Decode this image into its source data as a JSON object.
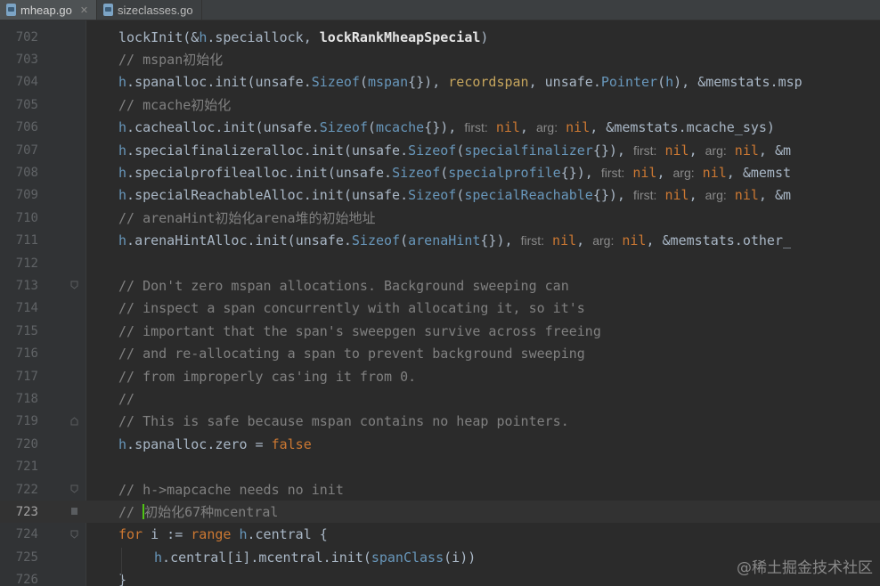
{
  "tabs": [
    {
      "label": "mheap.go",
      "active": true,
      "icon": "go-file-icon"
    },
    {
      "label": "sizeclasses.go",
      "active": false,
      "icon": "go-file-icon"
    }
  ],
  "editor": {
    "current_line": 723,
    "lines": [
      {
        "num": "702",
        "text": "lockInit(&h.speciallock, lockRankMheapSpecial)"
      },
      {
        "num": "703",
        "text": "// mspan初始化"
      },
      {
        "num": "704",
        "text": "h.spanalloc.init(unsafe.Sizeof(mspan{}), recordspan, unsafe.Pointer(h), &memstats.msp"
      },
      {
        "num": "705",
        "text": "// mcache初始化"
      },
      {
        "num": "706",
        "text": "h.cachealloc.init(unsafe.Sizeof(mcache{}), first: nil, arg: nil, &memstats.mcache_sys)"
      },
      {
        "num": "707",
        "text": "h.specialfinalizeralloc.init(unsafe.Sizeof(specialfinalizer{}), first: nil, arg: nil, &m"
      },
      {
        "num": "708",
        "text": "h.specialprofilealloc.init(unsafe.Sizeof(specialprofile{}), first: nil, arg: nil, &memst"
      },
      {
        "num": "709",
        "text": "h.specialReachableAlloc.init(unsafe.Sizeof(specialReachable{}), first: nil, arg: nil, &m"
      },
      {
        "num": "710",
        "text": "// arenaHint初始化arena堆的初始地址"
      },
      {
        "num": "711",
        "text": "h.arenaHintAlloc.init(unsafe.Sizeof(arenaHint{}), first: nil, arg: nil, &memstats.other_"
      },
      {
        "num": "712",
        "text": ""
      },
      {
        "num": "713",
        "text": "// Don't zero mspan allocations. Background sweeping can"
      },
      {
        "num": "714",
        "text": "// inspect a span concurrently with allocating it, so it's"
      },
      {
        "num": "715",
        "text": "// important that the span's sweepgen survive across freeing"
      },
      {
        "num": "716",
        "text": "// and re-allocating a span to prevent background sweeping"
      },
      {
        "num": "717",
        "text": "// from improperly cas'ing it from 0."
      },
      {
        "num": "718",
        "text": "//"
      },
      {
        "num": "719",
        "text": "// This is safe because mspan contains no heap pointers."
      },
      {
        "num": "720",
        "text": "h.spanalloc.zero = false"
      },
      {
        "num": "721",
        "text": ""
      },
      {
        "num": "722",
        "text": "// h->mapcache needs no init"
      },
      {
        "num": "723",
        "text": "// 初始化67种mcentral"
      },
      {
        "num": "724",
        "text": "for i := range h.central {"
      },
      {
        "num": "725",
        "text": "h.central[i].mcentral.init(spanClass(i))"
      },
      {
        "num": "726",
        "text": "}"
      }
    ]
  },
  "hints": {
    "first": "first:",
    "arg": "arg:"
  },
  "watermark": "@稀土掘金技术社区",
  "colors": {
    "background": "#2b2b2b",
    "gutter": "#313335",
    "keyword": "#cc7832",
    "comment": "#808080",
    "identifier": "#6897bb",
    "caret": "#4fc414"
  }
}
